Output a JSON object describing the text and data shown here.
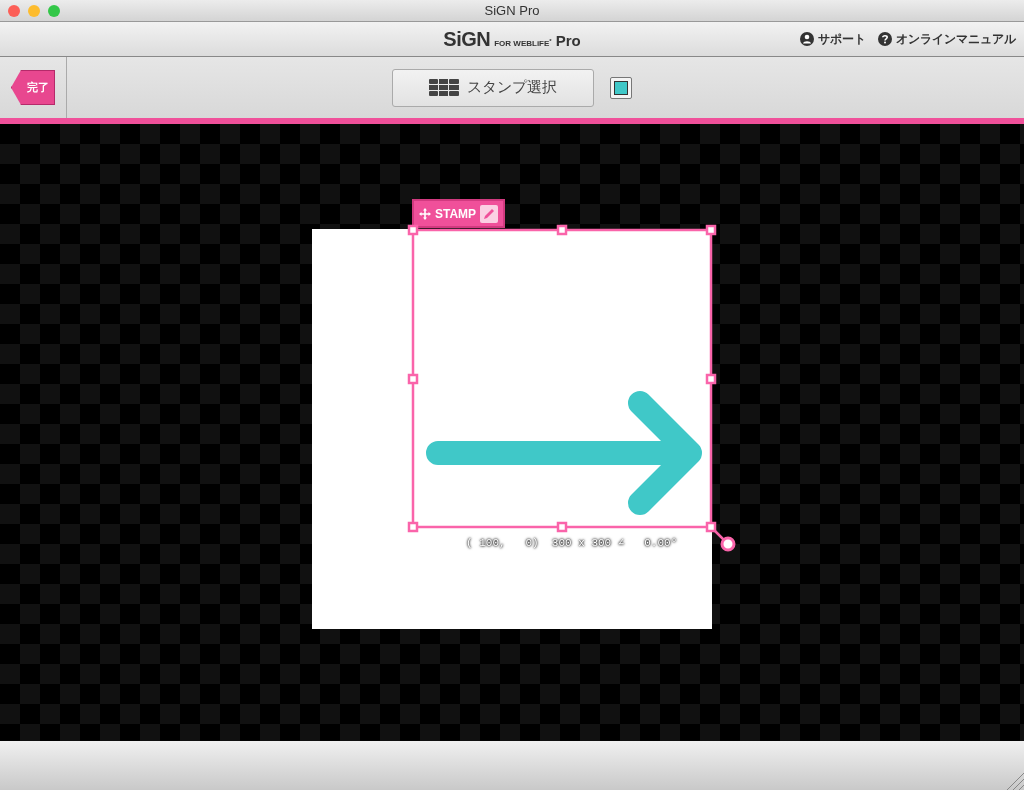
{
  "window": {
    "title": "SiGN Pro"
  },
  "header": {
    "logo": {
      "main": "SiGN",
      "sub": "FOR WEBLiFE$^{*}$",
      "edition": "Pro"
    },
    "links": [
      {
        "kind": "person",
        "label": "サポート"
      },
      {
        "kind": "help",
        "label": "オンラインマニュアル"
      }
    ]
  },
  "toolbar": {
    "done_button": "完了",
    "stamp_select_button": "スタンプ選択",
    "swatch": {
      "color": "#40c8c8"
    }
  },
  "canvas": {
    "stamp_label": "STAMP",
    "readout": "( 100,   0)  300 x 300 ∠   0.00°"
  }
}
